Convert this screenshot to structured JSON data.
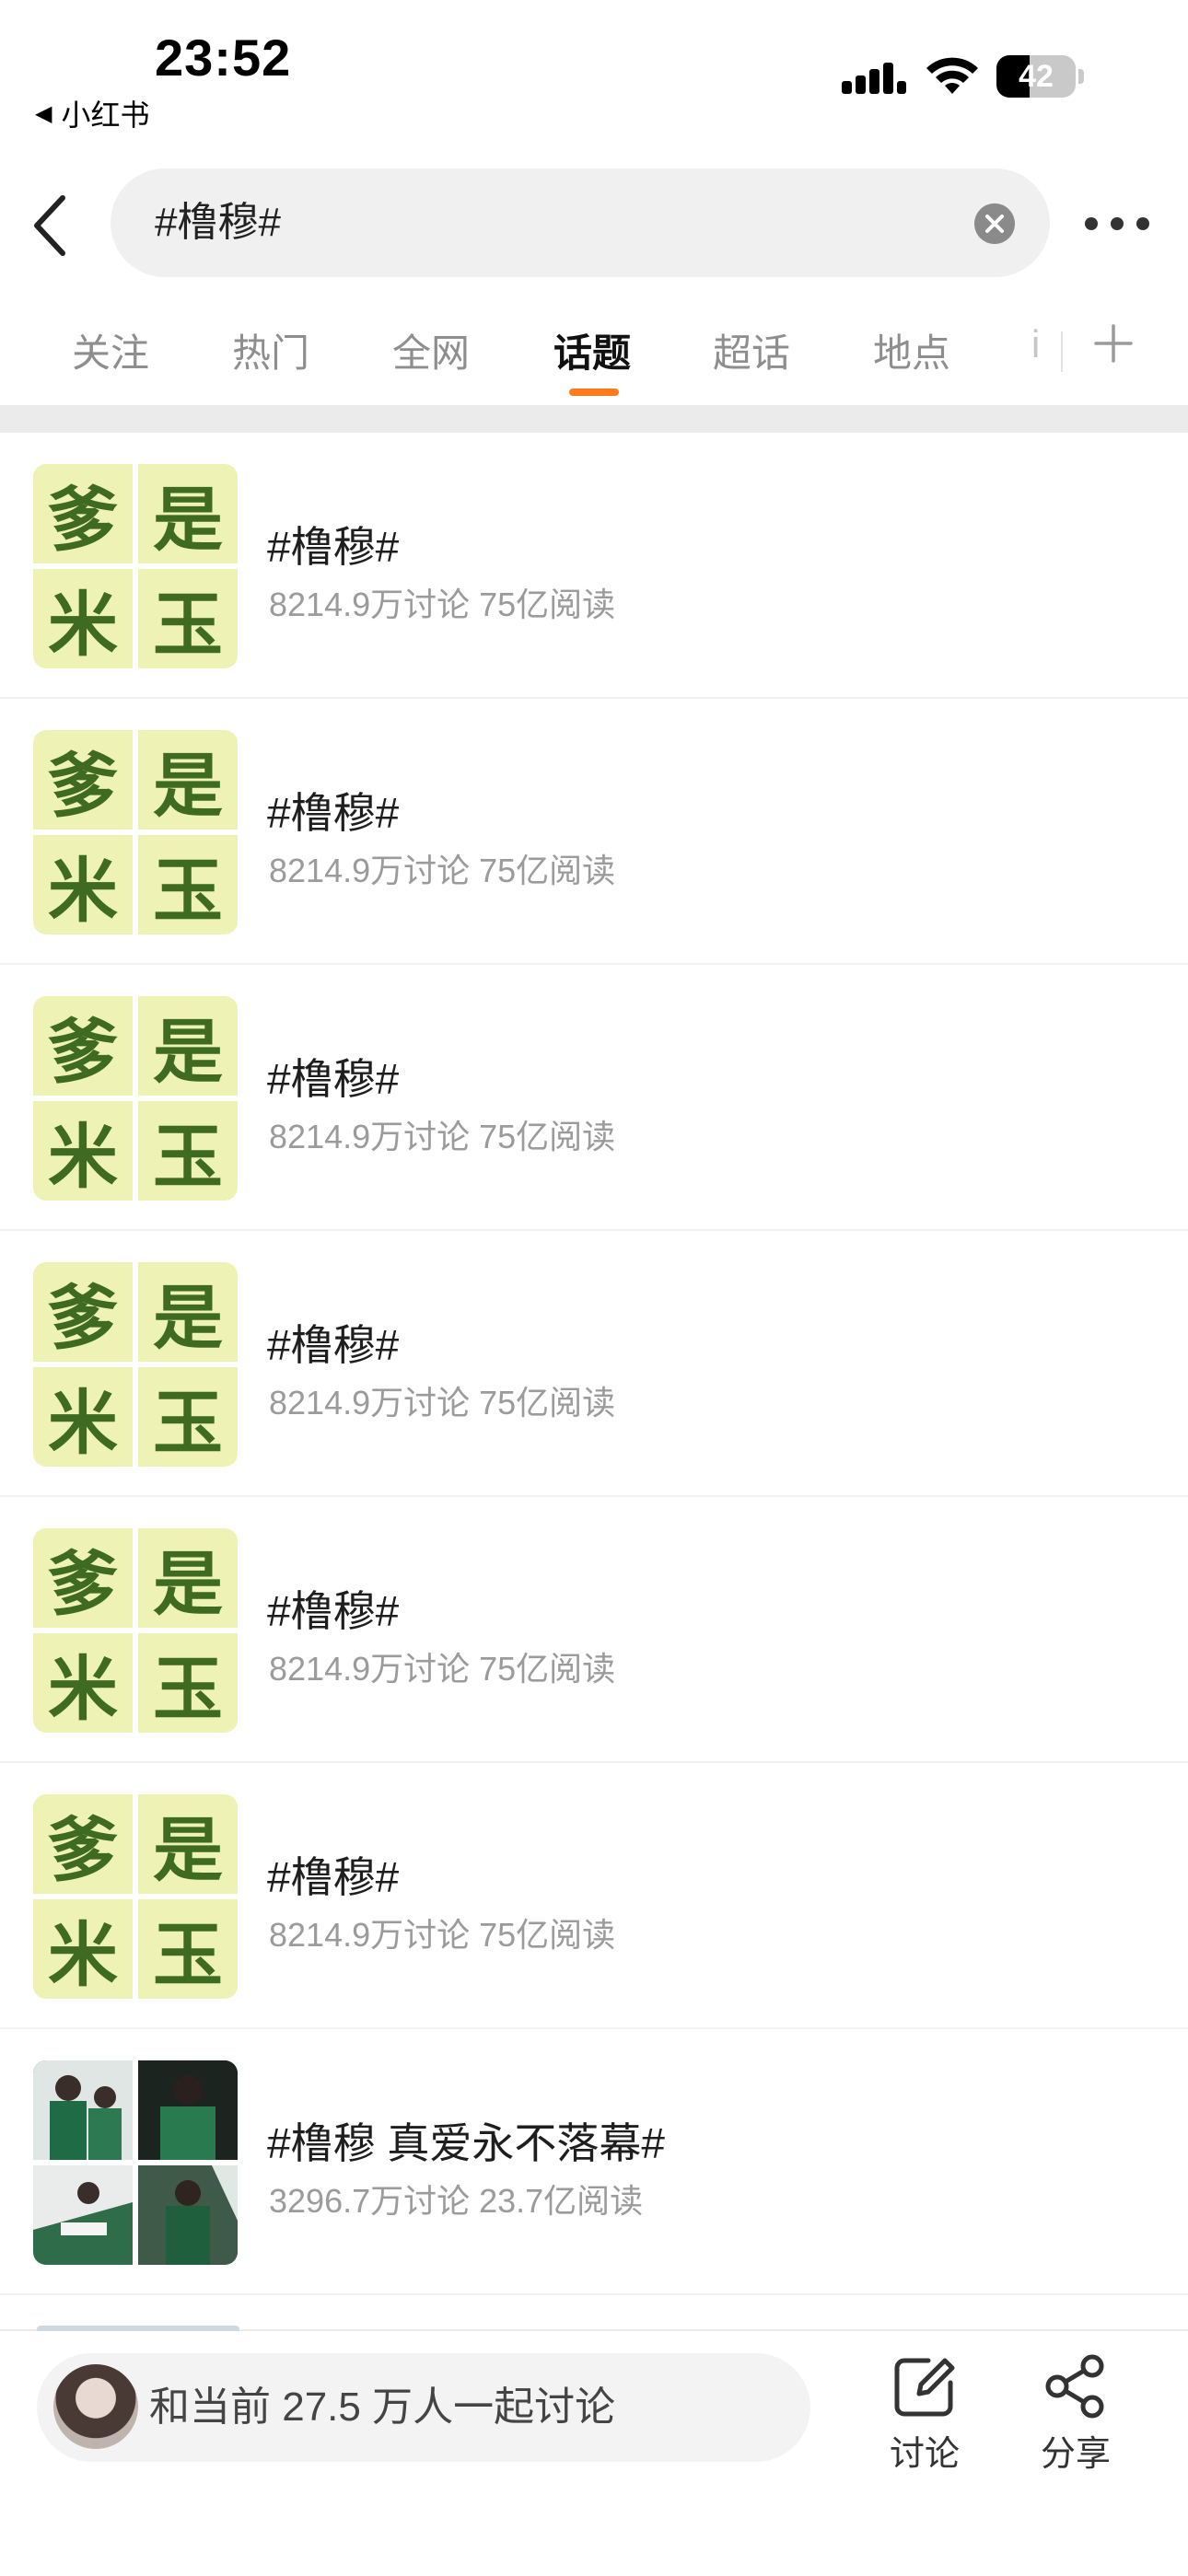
{
  "status_bar": {
    "time": "23:52",
    "back_app": "小红书",
    "battery": "42",
    "battery_level": 0.42
  },
  "search": {
    "query": "#橹穆#"
  },
  "tabs": [
    {
      "label": "关注"
    },
    {
      "label": "热门"
    },
    {
      "label": "全网"
    },
    {
      "label": "话题",
      "active": true
    },
    {
      "label": "超话"
    },
    {
      "label": "地点"
    },
    {
      "label": "i"
    }
  ],
  "topics": [
    {
      "title": "#橹穆#",
      "meta": "8214.9万讨论 75亿阅读",
      "thumb_chars": [
        "爹",
        "是",
        "米",
        "玉"
      ]
    },
    {
      "title": "#橹穆#",
      "meta": "8214.9万讨论 75亿阅读",
      "thumb_chars": [
        "爹",
        "是",
        "米",
        "玉"
      ]
    },
    {
      "title": "#橹穆#",
      "meta": "8214.9万讨论 75亿阅读",
      "thumb_chars": [
        "爹",
        "是",
        "米",
        "玉"
      ]
    },
    {
      "title": "#橹穆#",
      "meta": "8214.9万讨论 75亿阅读",
      "thumb_chars": [
        "爹",
        "是",
        "米",
        "玉"
      ]
    },
    {
      "title": "#橹穆#",
      "meta": "8214.9万讨论 75亿阅读",
      "thumb_chars": [
        "爹",
        "是",
        "米",
        "玉"
      ]
    },
    {
      "title": "#橹穆#",
      "meta": "8214.9万讨论 75亿阅读",
      "thumb_chars": [
        "爹",
        "是",
        "米",
        "玉"
      ]
    },
    {
      "title": "#橹穆 真爱永不落幕#",
      "meta": "3296.7万讨论 23.7亿阅读",
      "thumb_chars": []
    }
  ],
  "bottom_bar": {
    "prompt": "和当前 27.5 万人一起讨论",
    "discuss_label": "讨论",
    "share_label": "分享"
  },
  "colors": {
    "accent": "#ff7a1a",
    "thumb_bg": "#eef2b4",
    "thumb_text": "#3f6a22"
  }
}
